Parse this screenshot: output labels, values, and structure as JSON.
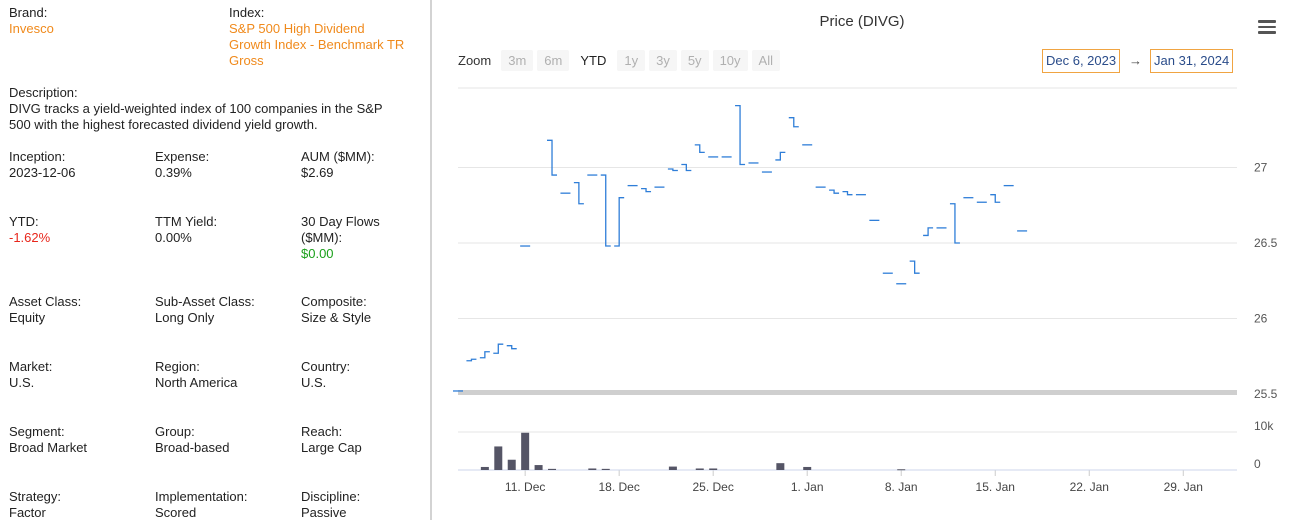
{
  "info": {
    "brand": {
      "label": "Brand:",
      "value": "Invesco"
    },
    "index": {
      "label": "Index:",
      "value_lines": [
        "S&P 500 High Dividend",
        "Growth Index - Benchmark TR",
        "Gross"
      ]
    },
    "description": {
      "label": "Description:",
      "lines": [
        "DIVG tracks a yield-weighted index of 100 companies in the S&P",
        "500 with the highest forecasted dividend yield growth."
      ]
    },
    "inception": {
      "label": "Inception:",
      "value": "2023-12-06"
    },
    "expense": {
      "label": "Expense:",
      "value": "0.39%"
    },
    "aum": {
      "label": "AUM ($MM):",
      "value": "$2.69"
    },
    "ytd": {
      "label": "YTD:",
      "value": "-1.62%"
    },
    "ttm_yield": {
      "label": "TTM Yield:",
      "value": "0.00%"
    },
    "flows": {
      "label_lines": [
        "30 Day Flows",
        "($MM):"
      ],
      "value": "$0.00"
    },
    "asset_class": {
      "label": "Asset Class:",
      "value": "Equity"
    },
    "sub_asset_class": {
      "label": "Sub-Asset Class:",
      "value": "Long Only"
    },
    "composite": {
      "label": "Composite:",
      "value": "Size & Style"
    },
    "market": {
      "label": "Market:",
      "value": "U.S."
    },
    "region": {
      "label": "Region:",
      "value": "North America"
    },
    "country": {
      "label": "Country:",
      "value": "U.S."
    },
    "segment": {
      "label": "Segment:",
      "value": "Broad Market"
    },
    "group": {
      "label": "Group:",
      "value": "Broad-based"
    },
    "reach": {
      "label": "Reach:",
      "value": "Large Cap"
    },
    "strategy": {
      "label": "Strategy:",
      "value": "Factor"
    },
    "implementation": {
      "label": "Implementation:",
      "value": "Scored"
    },
    "discipline": {
      "label": "Discipline:",
      "value": "Passive"
    }
  },
  "chart_header": {
    "title": "Price (DIVG)",
    "menu_icon": "hamburger-menu-icon",
    "zoom_label": "Zoom",
    "zoom_buttons": [
      "3m",
      "6m",
      "YTD",
      "1y",
      "3y",
      "5y",
      "10y",
      "All"
    ],
    "zoom_active": "YTD",
    "range_from": "Dec 6, 2023",
    "range_arrow": "→",
    "range_to": "Jan 31, 2024"
  },
  "colors": {
    "price_line": "#2f7ed8",
    "volume_bar": "#555566",
    "accent_orange": "#f08a1c",
    "negative_red": "#e8261b",
    "positive_green": "#1aa01a"
  },
  "chart_data": {
    "type": "line",
    "step": true,
    "title": "Price (DIVG)",
    "price_axis": {
      "ticks": [
        25.5,
        26,
        26.5,
        27
      ],
      "tick_labels": [
        "25.5",
        "26",
        "26.5",
        "27"
      ],
      "ylim": [
        25.5,
        27.5
      ]
    },
    "volume_axis": {
      "ticks": [
        0,
        10000
      ],
      "tick_labels": [
        "0",
        "10k"
      ],
      "ylim": [
        0,
        10000
      ]
    },
    "x_tick_labels": [
      "11. Dec",
      "18. Dec",
      "25. Dec",
      "1. Jan",
      "8. Jan",
      "15. Jan",
      "22. Jan",
      "29. Jan"
    ],
    "x_tick_days": [
      5,
      12,
      19,
      26,
      33,
      40,
      47,
      54
    ],
    "series": [
      {
        "kind": "price",
        "days": [
          0,
          1,
          2,
          3,
          4,
          5,
          7,
          8,
          9,
          10,
          11,
          12,
          13,
          14,
          15,
          16,
          17,
          18,
          19,
          20,
          21,
          22,
          23,
          24,
          25,
          26,
          27,
          28,
          29,
          30,
          31,
          32,
          33,
          34,
          35,
          36,
          37,
          38,
          39,
          40,
          41,
          42,
          43,
          44,
          45,
          46,
          47,
          48,
          49,
          50,
          51,
          52,
          53,
          54,
          55
        ],
        "open": [
          25.52,
          25.72,
          25.74,
          25.77,
          25.82,
          26.48,
          27.18,
          26.83,
          26.9,
          26.95,
          26.95,
          26.48,
          26.88,
          26.86,
          26.87,
          26.99,
          27.02,
          27.15,
          27.07,
          27.07,
          27.41,
          27.03,
          26.97,
          27.05,
          27.33,
          27.15,
          26.87,
          26.85,
          26.84,
          26.82,
          26.65,
          26.3,
          26.23,
          26.38,
          26.55,
          26.6,
          26.76,
          26.8,
          26.77,
          26.82,
          26.88,
          26.58
        ],
        "close": [
          25.52,
          25.73,
          25.78,
          25.83,
          25.8,
          26.48,
          26.95,
          26.83,
          26.76,
          26.95,
          26.48,
          26.8,
          26.88,
          26.84,
          26.87,
          26.98,
          26.98,
          27.1,
          27.07,
          27.07,
          27.02,
          27.03,
          26.97,
          27.1,
          27.27,
          27.15,
          26.87,
          26.83,
          26.82,
          26.82,
          26.65,
          26.3,
          26.23,
          26.3,
          26.6,
          26.6,
          26.5,
          26.8,
          26.77,
          26.77,
          26.88,
          26.58
        ]
      },
      {
        "kind": "volume",
        "days": [
          2,
          3,
          4,
          5,
          6,
          7,
          10,
          11,
          16,
          18,
          19,
          24,
          26,
          33
        ],
        "values": [
          800,
          6200,
          2700,
          9800,
          1300,
          300,
          400,
          300,
          900,
          400,
          400,
          1800,
          800,
          200
        ]
      }
    ],
    "grid": true
  }
}
